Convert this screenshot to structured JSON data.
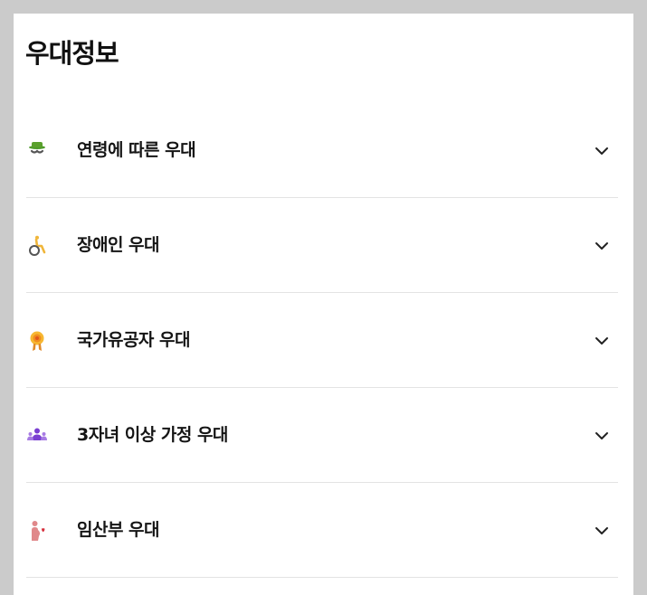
{
  "page": {
    "title": "우대정보"
  },
  "benefits": {
    "items": [
      {
        "label": "연령에 따른 우대",
        "icon": "elderly-person-icon",
        "expanded": false
      },
      {
        "label": "장애인 우대",
        "icon": "wheelchair-icon",
        "expanded": false
      },
      {
        "label": "국가유공자 우대",
        "icon": "medal-icon",
        "expanded": false
      },
      {
        "label": "3자녀 이상 가정 우대",
        "icon": "family-icon",
        "expanded": false
      },
      {
        "label": "임산부 우대",
        "icon": "pregnant-woman-icon",
        "expanded": false
      }
    ]
  },
  "colors": {
    "background": "#cbcbcb",
    "card": "#ffffff",
    "divider": "#e3e3e3",
    "text": "#151515",
    "elderly_icon": "#5aa02c",
    "wheelchair_icon": "#f0b63a",
    "medal_icon": "#f5a623",
    "family_icon": "#7a3fd1",
    "pregnant_icon": "#e0888a"
  }
}
